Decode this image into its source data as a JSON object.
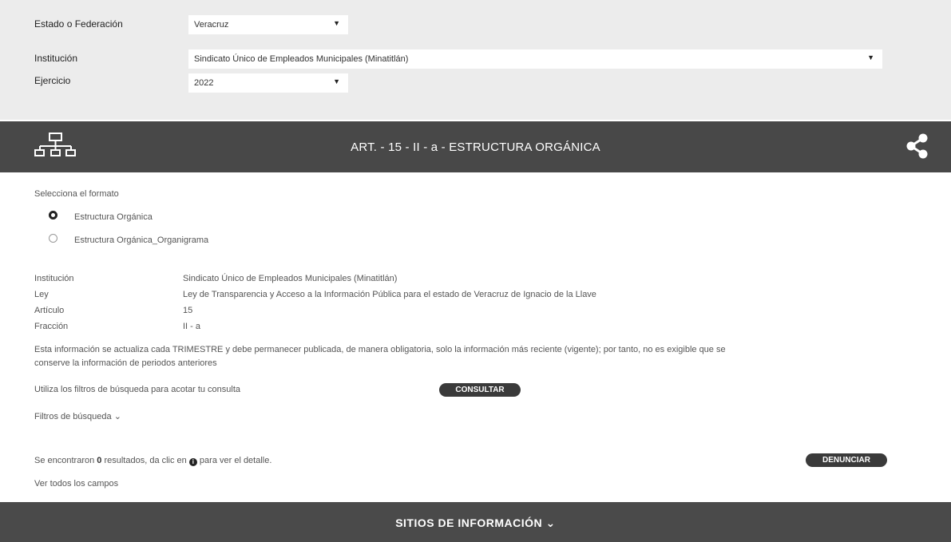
{
  "filters": {
    "estado_label": "Estado o Federación",
    "estado_value": "Veracruz",
    "institucion_label": "Institución",
    "institucion_value": "Sindicato Único de Empleados Municipales (Minatitlán)",
    "ejercicio_label": "Ejercicio",
    "ejercicio_value": "2022"
  },
  "banner": {
    "title": "ART. - 15 - II - a - ESTRUCTURA ORGÁNICA"
  },
  "formato": {
    "prompt": "Selecciona el formato",
    "options": [
      {
        "label": "Estructura Orgánica",
        "checked": true
      },
      {
        "label": "Estructura Orgánica_Organigrama",
        "checked": false
      }
    ]
  },
  "details": {
    "institucion_label": "Institución",
    "institucion_value": "Sindicato Único de Empleados Municipales (Minatitlán)",
    "ley_label": "Ley",
    "ley_value": "Ley de Transparencia y Acceso a la Información Pública para el estado de Veracruz de Ignacio de la Llave",
    "articulo_label": "Artículo",
    "articulo_value": "15",
    "fraccion_label": "Fracción",
    "fraccion_value": "II - a",
    "note_line1": "Esta información se actualiza cada TRIMESTRE y debe permanecer publicada, de manera obligatoria, solo la información más reciente (vigente); por tanto, no es exigible que se",
    "note_line2": "conserve la información de periodos anteriores"
  },
  "search": {
    "hint": "Utiliza los filtros de búsqueda para acotar tu consulta",
    "consultar_label": "CONSULTAR",
    "filtros_label": "Filtros de búsqueda"
  },
  "results": {
    "text_before": "Se encontraron ",
    "count": "0",
    "text_mid": " resultados, da clic en ",
    "text_after": " para ver el detalle.",
    "denunciar_label": "DENUNCIAR",
    "ver_todos": "Ver todos los campos"
  },
  "footer": {
    "title": "SITIOS DE INFORMACIÓN"
  }
}
